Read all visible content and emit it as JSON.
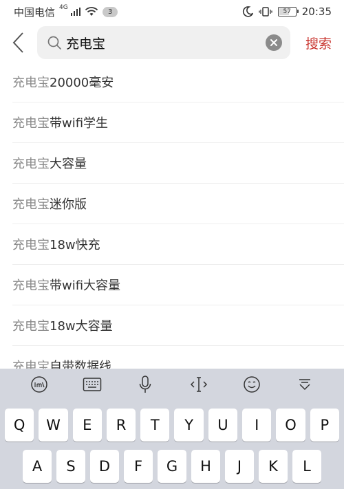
{
  "status_bar": {
    "carrier": "中国电信",
    "network": "4G",
    "notification_count": "3",
    "battery": "57",
    "time": "20:35"
  },
  "search": {
    "query": "充电宝",
    "button_label": "搜索"
  },
  "suggestions": [
    {
      "prefix": "充电宝",
      "rest": "20000毫安"
    },
    {
      "prefix": "充电宝",
      "rest": "带wifi学生"
    },
    {
      "prefix": "充电宝",
      "rest": "大容量"
    },
    {
      "prefix": "充电宝",
      "rest": "迷你版"
    },
    {
      "prefix": "充电宝",
      "rest": "18w快充"
    },
    {
      "prefix": "充电宝",
      "rest": "带wifi大容量"
    },
    {
      "prefix": "充电宝",
      "rest": "18w大容量"
    },
    {
      "prefix": "充电宝",
      "rest": "自带数据线"
    }
  ],
  "keyboard": {
    "toolbar_icons": [
      "ime-logo-icon",
      "keyboard-icon",
      "microphone-icon",
      "cursor-icon",
      "emoji-icon",
      "collapse-keyboard-icon"
    ],
    "row1": [
      "Q",
      "W",
      "E",
      "R",
      "T",
      "Y",
      "U",
      "I",
      "O",
      "P"
    ],
    "row2": [
      "A",
      "S",
      "D",
      "F",
      "G",
      "H",
      "J",
      "K",
      "L"
    ]
  },
  "colors": {
    "accent": "#c8322c",
    "keyboard_bg": "#d3d6de",
    "search_bg": "#f0f0f0"
  }
}
